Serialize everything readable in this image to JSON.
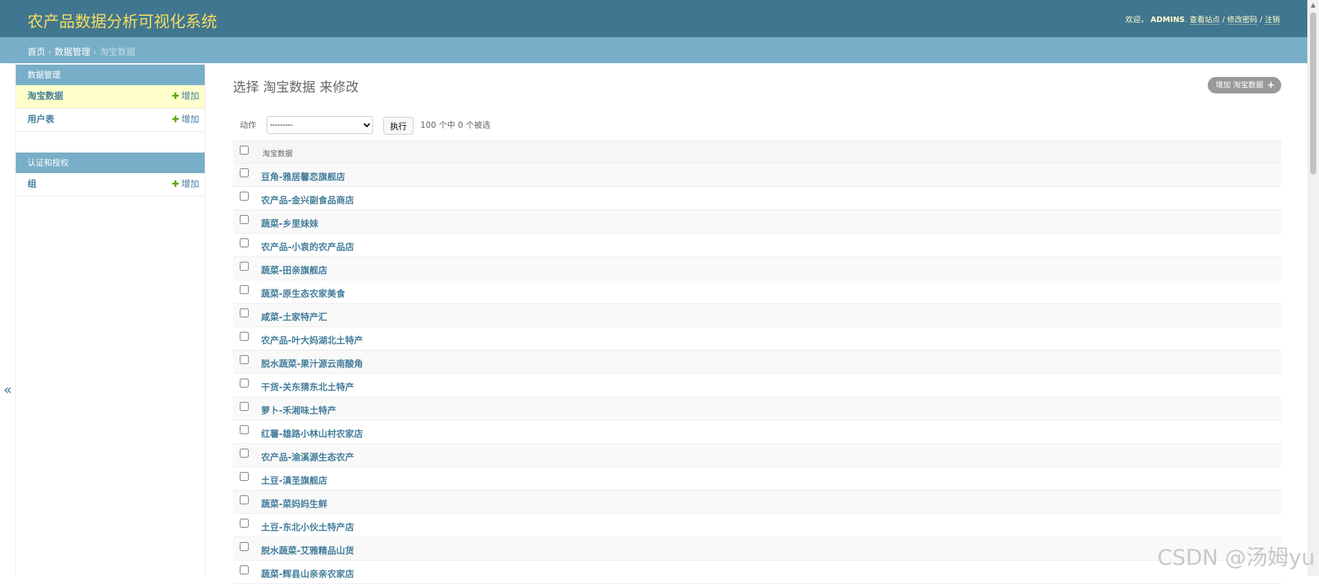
{
  "header": {
    "title": "农产品数据分析可视化系统",
    "welcome": "欢迎，",
    "username": "ADMINS",
    "links": [
      "查看站点",
      "修改密码",
      "注销"
    ],
    "separator": " / "
  },
  "breadcrumb": {
    "items": [
      "首页",
      "数据管理",
      "淘宝数据"
    ],
    "sep": " › "
  },
  "sidebar": {
    "toggle": "«",
    "modules": [
      {
        "caption": "数据管理",
        "rows": [
          {
            "label": "淘宝数据",
            "add": "增加"
          },
          {
            "label": "用户表",
            "add": "增加"
          }
        ]
      },
      {
        "caption": "认证和授权",
        "rows": [
          {
            "label": "组",
            "add": "增加"
          }
        ]
      }
    ]
  },
  "main": {
    "title": "选择 淘宝数据 来修改",
    "add_button": "增加 淘宝数据",
    "actions": {
      "label": "动作",
      "select_value": "---------",
      "run_label": "执行",
      "counter": "100 个中 0 个被选"
    },
    "table": {
      "header": "淘宝数据",
      "rows": [
        "豆角-雅居馨恋旗舰店",
        "农产品-金兴副食品商店",
        "蔬菜-乡里妹妹",
        "农产品-小袁的农产品店",
        "蔬菜-田亲旗舰店",
        "蔬菜-原生态农家美食",
        "咸菜-土家特产汇",
        "农产品-叶大妈湖北土特产",
        "脱水蔬菜-果汁源云南酸角",
        "干货-关东猜东北土特产",
        "萝卜-禾湘味土特产",
        "红薯-雄路小林山村农家店",
        "农产品-渝溪源生态农产",
        "土豆-滇圣旗舰店",
        "蔬菜-菜妈妈生鲜",
        "土豆-东北小伙土特产店",
        "脱水蔬菜-艾雅精品山货",
        "蔬菜-辉县山亲亲农家店"
      ]
    }
  },
  "watermark": "CSDN @汤姆yu",
  "colors": {
    "header_bg": "#417690",
    "breadcrumb_bg": "#79aec8",
    "brand": "#f5dd5d",
    "link": "#447e9b",
    "active_row": "#ffffcc"
  }
}
